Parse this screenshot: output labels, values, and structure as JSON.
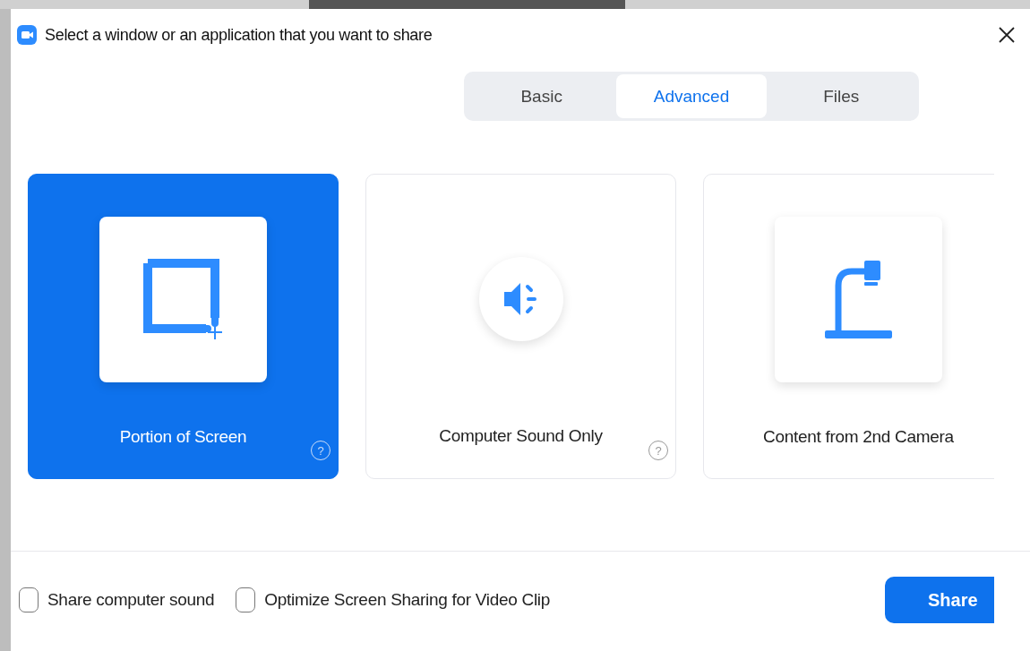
{
  "window": {
    "title": "Select a window or an application that you want to share"
  },
  "tabs": [
    {
      "label": "Basic",
      "selected": false
    },
    {
      "label": "Advanced",
      "selected": true
    },
    {
      "label": "Files",
      "selected": false
    }
  ],
  "options": [
    {
      "label": "Portion of Screen",
      "kind": "portion",
      "selected": true,
      "help": "?"
    },
    {
      "label": "Computer Sound Only",
      "kind": "sound",
      "selected": false,
      "help": "?"
    },
    {
      "label": "Content from 2nd Camera",
      "kind": "camera",
      "selected": false
    }
  ],
  "checkboxes": [
    {
      "label": "Share computer sound",
      "checked": false
    },
    {
      "label": "Optimize Screen Sharing for Video Clip",
      "checked": false
    }
  ],
  "share_button": "Share"
}
